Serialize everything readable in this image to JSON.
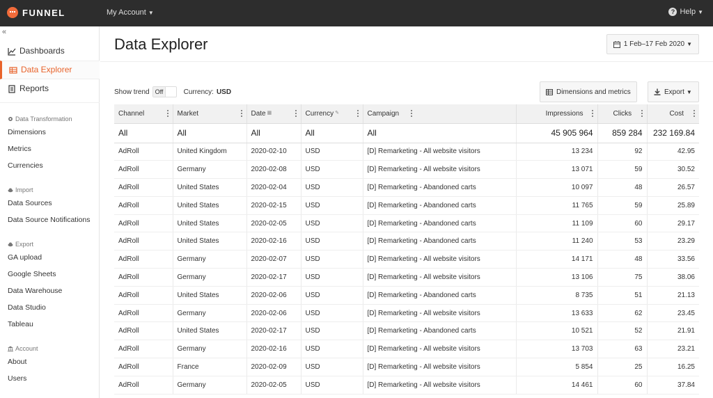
{
  "app": {
    "logo_text": "FUNNEL",
    "account_menu": "My Account",
    "help": "Help"
  },
  "sidebar": {
    "collapse_glyph": "«",
    "main_items": [
      {
        "label": "Dashboards",
        "icon": "line-chart-icon"
      },
      {
        "label": "Data Explorer",
        "icon": "table-icon",
        "active": true
      },
      {
        "label": "Reports",
        "icon": "document-icon"
      }
    ],
    "sections": [
      {
        "title": "Data Transformation",
        "icon": "gear-icon",
        "items": [
          "Dimensions",
          "Metrics",
          "Currencies"
        ]
      },
      {
        "title": "Import",
        "icon": "cloud-icon",
        "items": [
          "Data Sources",
          "Data Source Notifications"
        ]
      },
      {
        "title": "Export",
        "icon": "cloud-upload-icon",
        "items": [
          "GA upload",
          "Google Sheets",
          "Data Warehouse",
          "Data Studio",
          "Tableau"
        ]
      },
      {
        "title": "Account",
        "icon": "bank-icon",
        "items": [
          "About",
          "Users"
        ]
      }
    ]
  },
  "main": {
    "title": "Data Explorer",
    "date_range": "1 Feb–17 Feb 2020",
    "show_trend_label": "Show trend",
    "toggle_value": "Off",
    "currency_label": "Currency:",
    "currency_value": "USD",
    "dims_button": "Dimensions and metrics",
    "export_button": "Export"
  },
  "table": {
    "columns": [
      "Channel",
      "Market",
      "Date",
      "Currency",
      "Campaign",
      "Impressions",
      "Clicks",
      "Cost"
    ],
    "totals": [
      "All",
      "All",
      "All",
      "All",
      "All",
      "45 905 964",
      "859 284",
      "232 169.84"
    ],
    "rows": [
      [
        "AdRoll",
        "United Kingdom",
        "2020-02-10",
        "USD",
        "[D] Remarketing - All website visitors",
        "13 234",
        "92",
        "42.95"
      ],
      [
        "AdRoll",
        "Germany",
        "2020-02-08",
        "USD",
        "[D] Remarketing - All website visitors",
        "13 071",
        "59",
        "30.52"
      ],
      [
        "AdRoll",
        "United States",
        "2020-02-04",
        "USD",
        "[D] Remarketing - Abandoned carts",
        "10 097",
        "48",
        "26.57"
      ],
      [
        "AdRoll",
        "United States",
        "2020-02-15",
        "USD",
        "[D] Remarketing - Abandoned carts",
        "11 765",
        "59",
        "25.89"
      ],
      [
        "AdRoll",
        "United States",
        "2020-02-05",
        "USD",
        "[D] Remarketing - Abandoned carts",
        "11 109",
        "60",
        "29.17"
      ],
      [
        "AdRoll",
        "United States",
        "2020-02-16",
        "USD",
        "[D] Remarketing - Abandoned carts",
        "11 240",
        "53",
        "23.29"
      ],
      [
        "AdRoll",
        "Germany",
        "2020-02-07",
        "USD",
        "[D] Remarketing - All website visitors",
        "14 171",
        "48",
        "33.56"
      ],
      [
        "AdRoll",
        "Germany",
        "2020-02-17",
        "USD",
        "[D] Remarketing - All website visitors",
        "13 106",
        "75",
        "38.06"
      ],
      [
        "AdRoll",
        "United States",
        "2020-02-06",
        "USD",
        "[D] Remarketing - Abandoned carts",
        "8 735",
        "51",
        "21.13"
      ],
      [
        "AdRoll",
        "Germany",
        "2020-02-06",
        "USD",
        "[D] Remarketing - All website visitors",
        "13 633",
        "62",
        "23.45"
      ],
      [
        "AdRoll",
        "United States",
        "2020-02-17",
        "USD",
        "[D] Remarketing - Abandoned carts",
        "10 521",
        "52",
        "21.91"
      ],
      [
        "AdRoll",
        "Germany",
        "2020-02-16",
        "USD",
        "[D] Remarketing - All website visitors",
        "13 703",
        "63",
        "23.21"
      ],
      [
        "AdRoll",
        "France",
        "2020-02-09",
        "USD",
        "[D] Remarketing - All website visitors",
        "5 854",
        "25",
        "16.25"
      ],
      [
        "AdRoll",
        "Germany",
        "2020-02-05",
        "USD",
        "[D] Remarketing - All website visitors",
        "14 461",
        "60",
        "37.84"
      ]
    ]
  },
  "colors": {
    "topbar": "#2d2d2d",
    "accent": "#e8632b",
    "logo": "#f26b3a"
  }
}
